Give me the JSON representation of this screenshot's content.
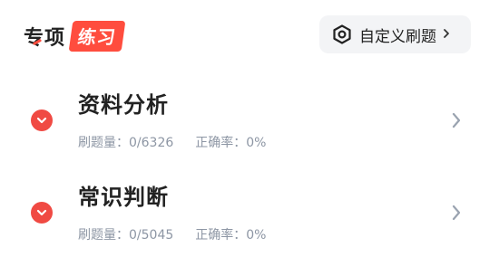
{
  "header": {
    "title": "专项",
    "badge": "练习",
    "custom_button_label": "自定义刷题",
    "custom_button_icon": "settings-hexagon-icon",
    "custom_button_chevron": "chevron-right-icon"
  },
  "categories": [
    {
      "title": "资料分析",
      "count_text": "刷题量：0/6326",
      "rate_text": "正确率：0%",
      "toggle_icon": "chevron-down-icon",
      "arrow_icon": "chevron-right-icon"
    },
    {
      "title": "常识判断",
      "count_text": "刷题量：0/5045",
      "rate_text": "正确率：0%",
      "toggle_icon": "chevron-down-icon",
      "arrow_icon": "chevron-right-icon"
    }
  ],
  "colors": {
    "accent": "#ff4d3e",
    "muted_text": "#8d96a4",
    "button_bg": "#f3f4f6"
  }
}
